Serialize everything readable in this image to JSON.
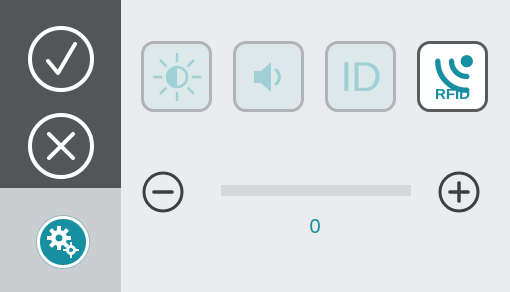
{
  "sidebar": {
    "confirm_icon": "check-circle-icon",
    "cancel_icon": "close-circle-icon",
    "settings_icon": "gears-icon"
  },
  "modes": [
    {
      "name": "light",
      "icon": "brightness-icon",
      "selected": false
    },
    {
      "name": "sound",
      "icon": "speaker-icon",
      "selected": false
    },
    {
      "name": "id",
      "icon": "id-icon",
      "label": "ID",
      "selected": false
    },
    {
      "name": "rfid",
      "icon": "rfid-icon",
      "label": "RFID",
      "selected": true
    }
  ],
  "level": {
    "value": "0",
    "fraction": 0,
    "minus_icon": "minus-circle-icon",
    "plus_icon": "plus-circle-icon"
  },
  "colors": {
    "accent": "#178fa3",
    "sidebar_dark": "#535659",
    "button_outline": "#b1b4b6",
    "selected_outline": "#595c5f"
  }
}
